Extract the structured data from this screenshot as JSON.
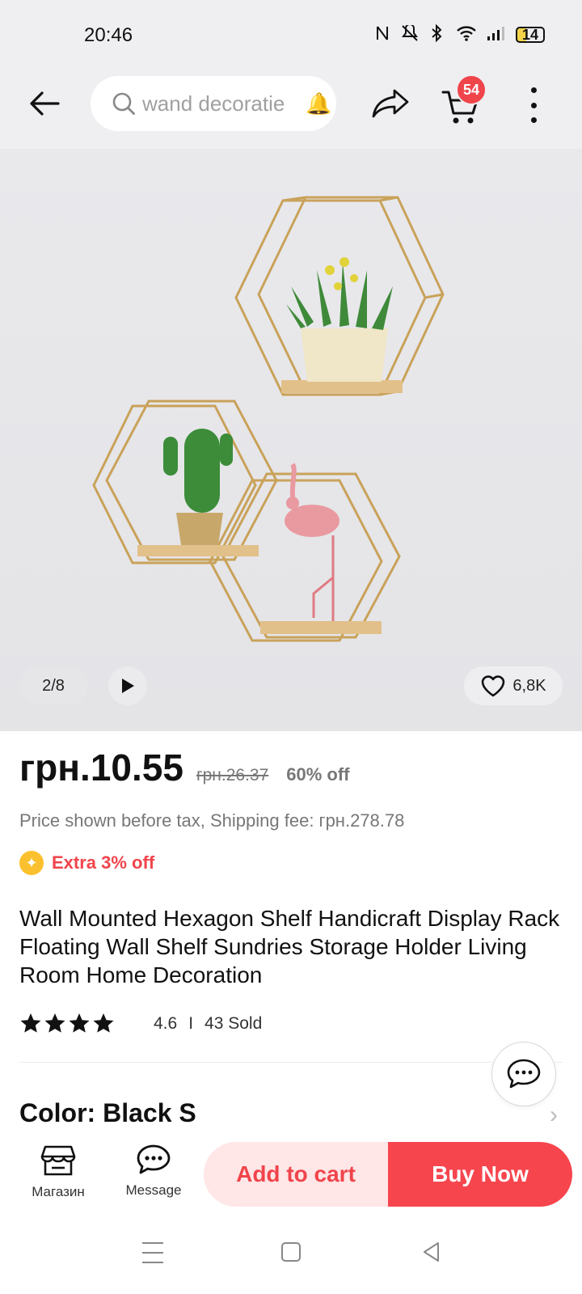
{
  "status": {
    "time": "20:46",
    "battery": "14",
    "icons": [
      "nfc-icon",
      "mute-icon",
      "bluetooth-icon",
      "wifi-icon",
      "signal-icon",
      "battery-icon"
    ]
  },
  "header": {
    "search_placeholder": "wand decoratie",
    "cart_count": "54"
  },
  "gallery": {
    "counter": "2/8",
    "wishlist_count": "6,8K"
  },
  "price": {
    "current": "грн.10.55",
    "original": "грн.26.37",
    "discount": "60% off",
    "tax_note": "Price shown before tax, Shipping fee: грн.278.78",
    "extra": "Extra 3% off"
  },
  "product": {
    "title": "Wall Mounted Hexagon Shelf Handicraft Display Rack Floating Wall Shelf Sundries Storage Holder Living Room Home Decoration",
    "rating": "4.6",
    "rating_value": 4.6,
    "separator": "I",
    "sold": "43 Sold",
    "color_label": "Color: Black S"
  },
  "bottom_bar": {
    "store_label": "Магазин",
    "message_label": "Message",
    "add_to_cart": "Add to cart",
    "buy_now": "Buy Now"
  },
  "colors": {
    "accent": "#f7454e",
    "accent_light": "#ffe6e7",
    "badge": "#f0444b"
  }
}
